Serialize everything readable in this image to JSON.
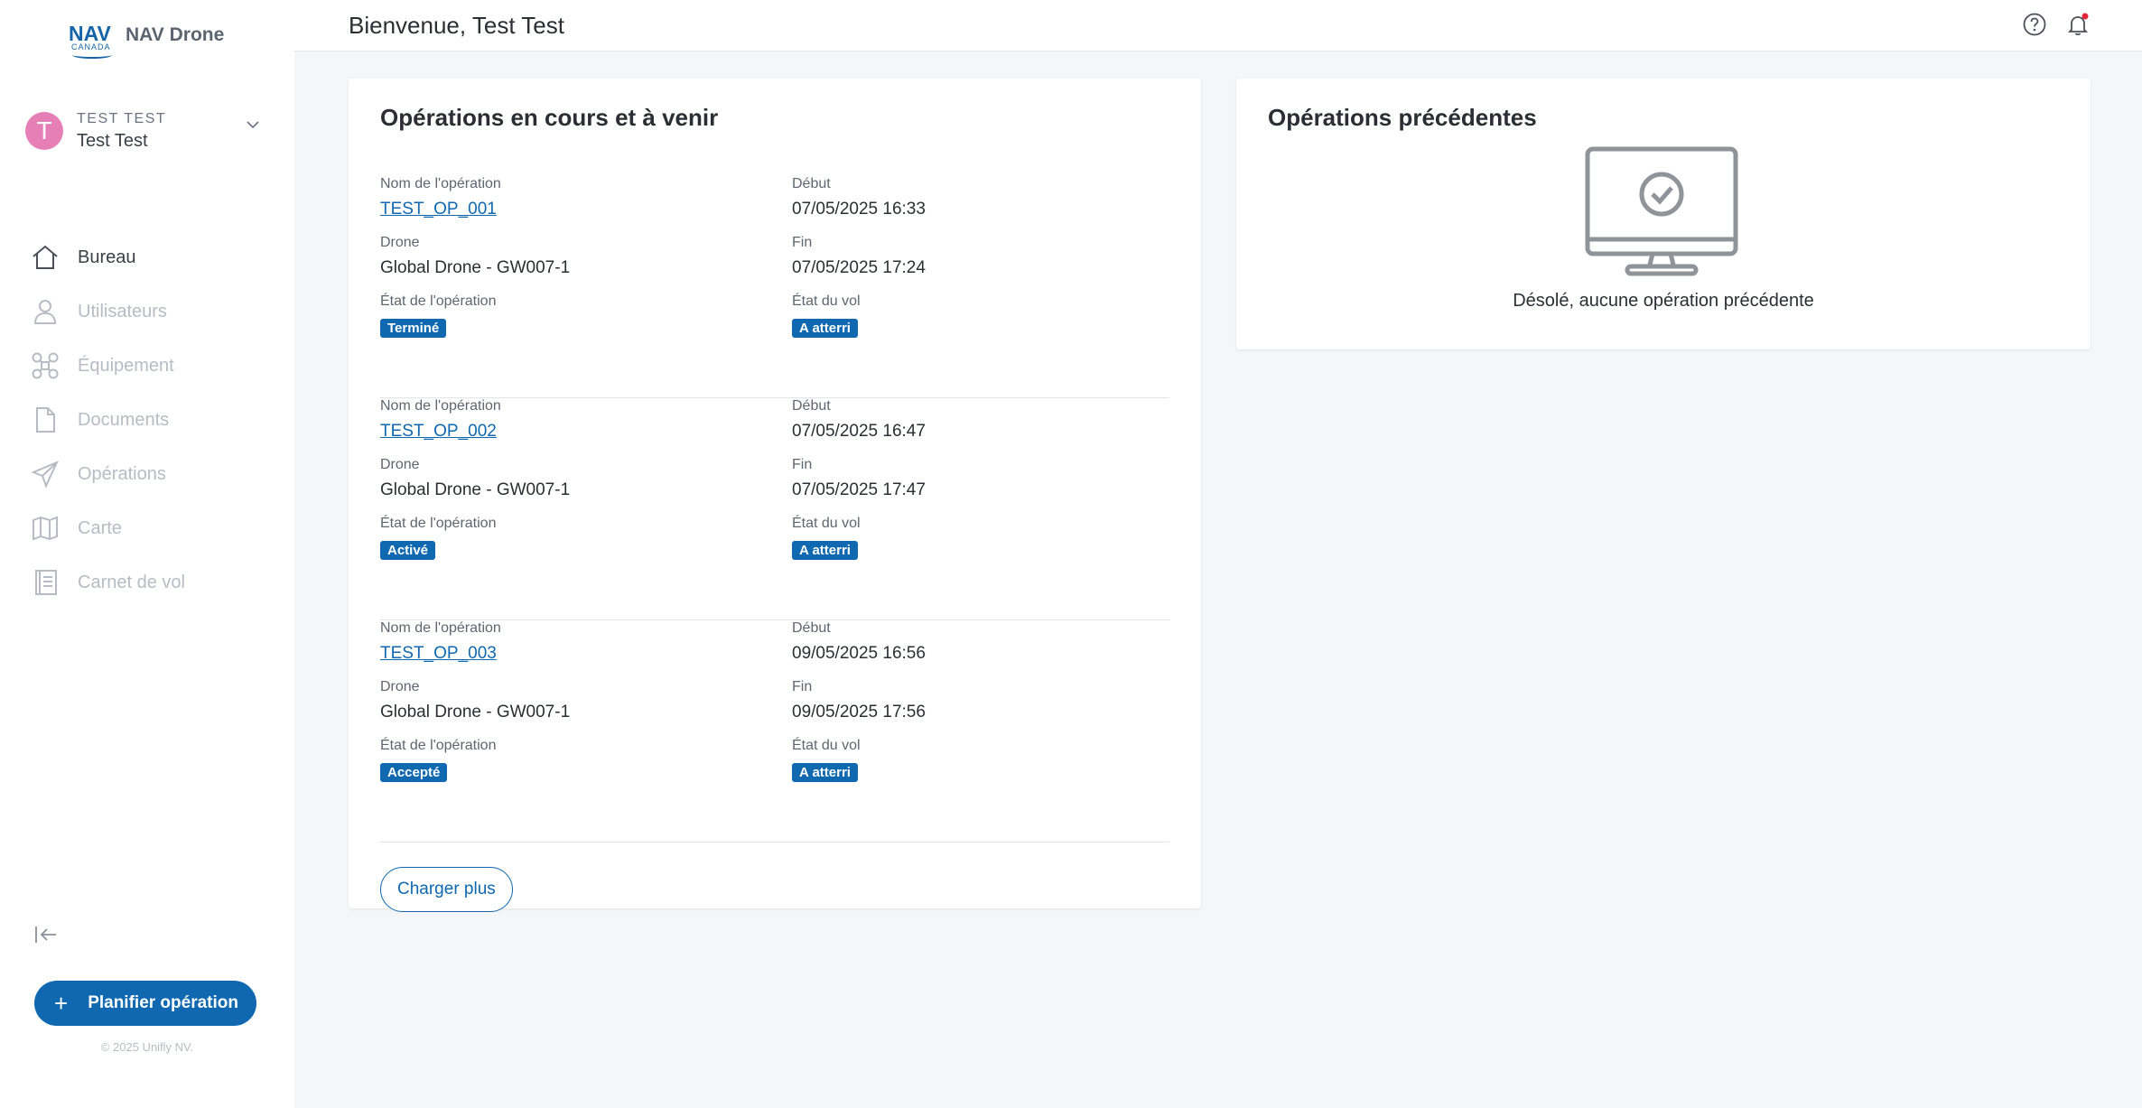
{
  "brand": {
    "logo_text": "NAV",
    "logo_sub": "CANADA",
    "name": "NAV Drone"
  },
  "user": {
    "initial": "T",
    "org": "TEST TEST",
    "name": "Test Test"
  },
  "nav": [
    {
      "label": "Bureau",
      "icon": "home-icon",
      "active": true
    },
    {
      "label": "Utilisateurs",
      "icon": "user-icon",
      "active": false
    },
    {
      "label": "Équipement",
      "icon": "drone-icon",
      "active": false
    },
    {
      "label": "Documents",
      "icon": "document-icon",
      "active": false
    },
    {
      "label": "Opérations",
      "icon": "paper-plane-icon",
      "active": false
    },
    {
      "label": "Carte",
      "icon": "map-icon",
      "active": false
    },
    {
      "label": "Carnet de vol",
      "icon": "logbook-icon",
      "active": false
    }
  ],
  "plan_button": {
    "plus": "+",
    "label": "Planifier opération"
  },
  "copyright": "© 2025 Unifly NV.",
  "header": {
    "welcome": "Bienvenue, Test Test"
  },
  "current_ops": {
    "title": "Opérations en cours et à venir",
    "labels": {
      "name": "Nom de l'opération",
      "start": "Début",
      "drone": "Drone",
      "end": "Fin",
      "op_state": "État de l'opération",
      "flight_state": "État du vol"
    },
    "items": [
      {
        "name": "TEST_OP_001",
        "start": "07/05/2025 16:33",
        "drone": "Global Drone - GW007-1",
        "end": "07/05/2025 17:24",
        "op_state": "Terminé",
        "flight_state": "A atterri"
      },
      {
        "name": "TEST_OP_002",
        "start": "07/05/2025 16:47",
        "drone": "Global Drone - GW007-1",
        "end": "07/05/2025 17:47",
        "op_state": "Activé",
        "flight_state": "A atterri"
      },
      {
        "name": "TEST_OP_003",
        "start": "09/05/2025 16:56",
        "drone": "Global Drone - GW007-1",
        "end": "09/05/2025 17:56",
        "op_state": "Accepté",
        "flight_state": "A atterri"
      }
    ],
    "load_more": "Charger plus"
  },
  "previous_ops": {
    "title": "Opérations précédentes",
    "empty_icon": "monitor-check-icon",
    "empty_text": "Désolé, aucune opération précédente"
  },
  "colors": {
    "accent": "#0f68b0",
    "avatar": "#e77fb7",
    "notification_dot": "#e5253b"
  }
}
